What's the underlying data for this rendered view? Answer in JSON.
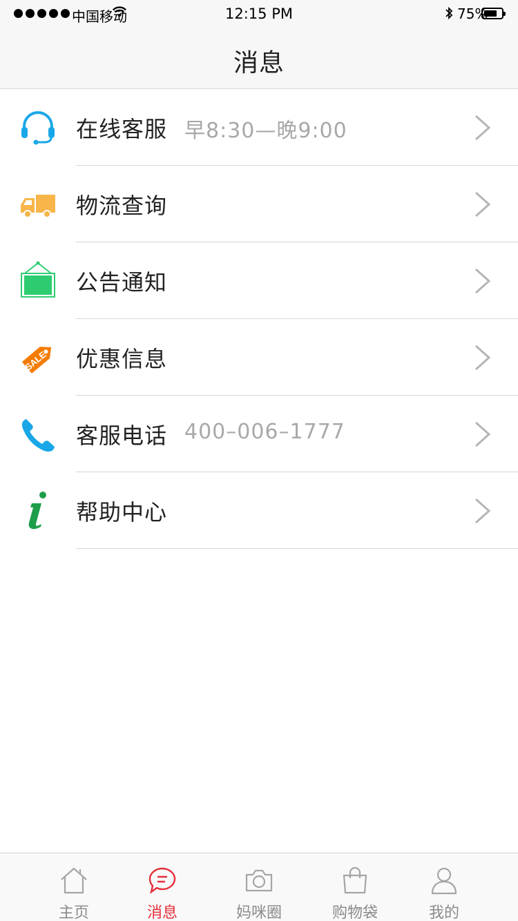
{
  "status_bar": {
    "carrier": "中国移动",
    "time": "12:15 PM",
    "battery": "75%",
    "battery_level": 0.75
  },
  "nav": {
    "title": "消息"
  },
  "menu": [
    {
      "label": "在线客服",
      "sub": "早8:30—晚9:00",
      "icon": "headset-icon",
      "color": "#1aa7e8"
    },
    {
      "label": "物流查询",
      "sub": "",
      "icon": "truck-icon",
      "color": "#f7b54a"
    },
    {
      "label": "公告通知",
      "sub": "",
      "icon": "notice-board-icon",
      "color": "#2ecc71"
    },
    {
      "label": "优惠信息",
      "sub": "",
      "icon": "sale-tag-icon",
      "color": "#f57c00",
      "tag_text": "SALE"
    },
    {
      "label": "客服电话",
      "sub": "400–006–1777",
      "icon": "phone-icon",
      "color": "#1aa7e8"
    },
    {
      "label": "帮助中心",
      "sub": "",
      "icon": "info-icon",
      "color": "#1e9e4a"
    }
  ],
  "tabs": [
    {
      "label": "主页",
      "icon": "home-icon"
    },
    {
      "label": "消息",
      "icon": "message-icon",
      "active": true
    },
    {
      "label": "妈咪圈",
      "icon": "camera-icon"
    },
    {
      "label": "购物袋",
      "icon": "shopping-bag-icon"
    },
    {
      "label": "我的",
      "icon": "user-icon"
    }
  ],
  "colors": {
    "accent": "#e62e3a",
    "tab_inactive": "#8a8a8a",
    "subtext": "#a8a8a8"
  }
}
